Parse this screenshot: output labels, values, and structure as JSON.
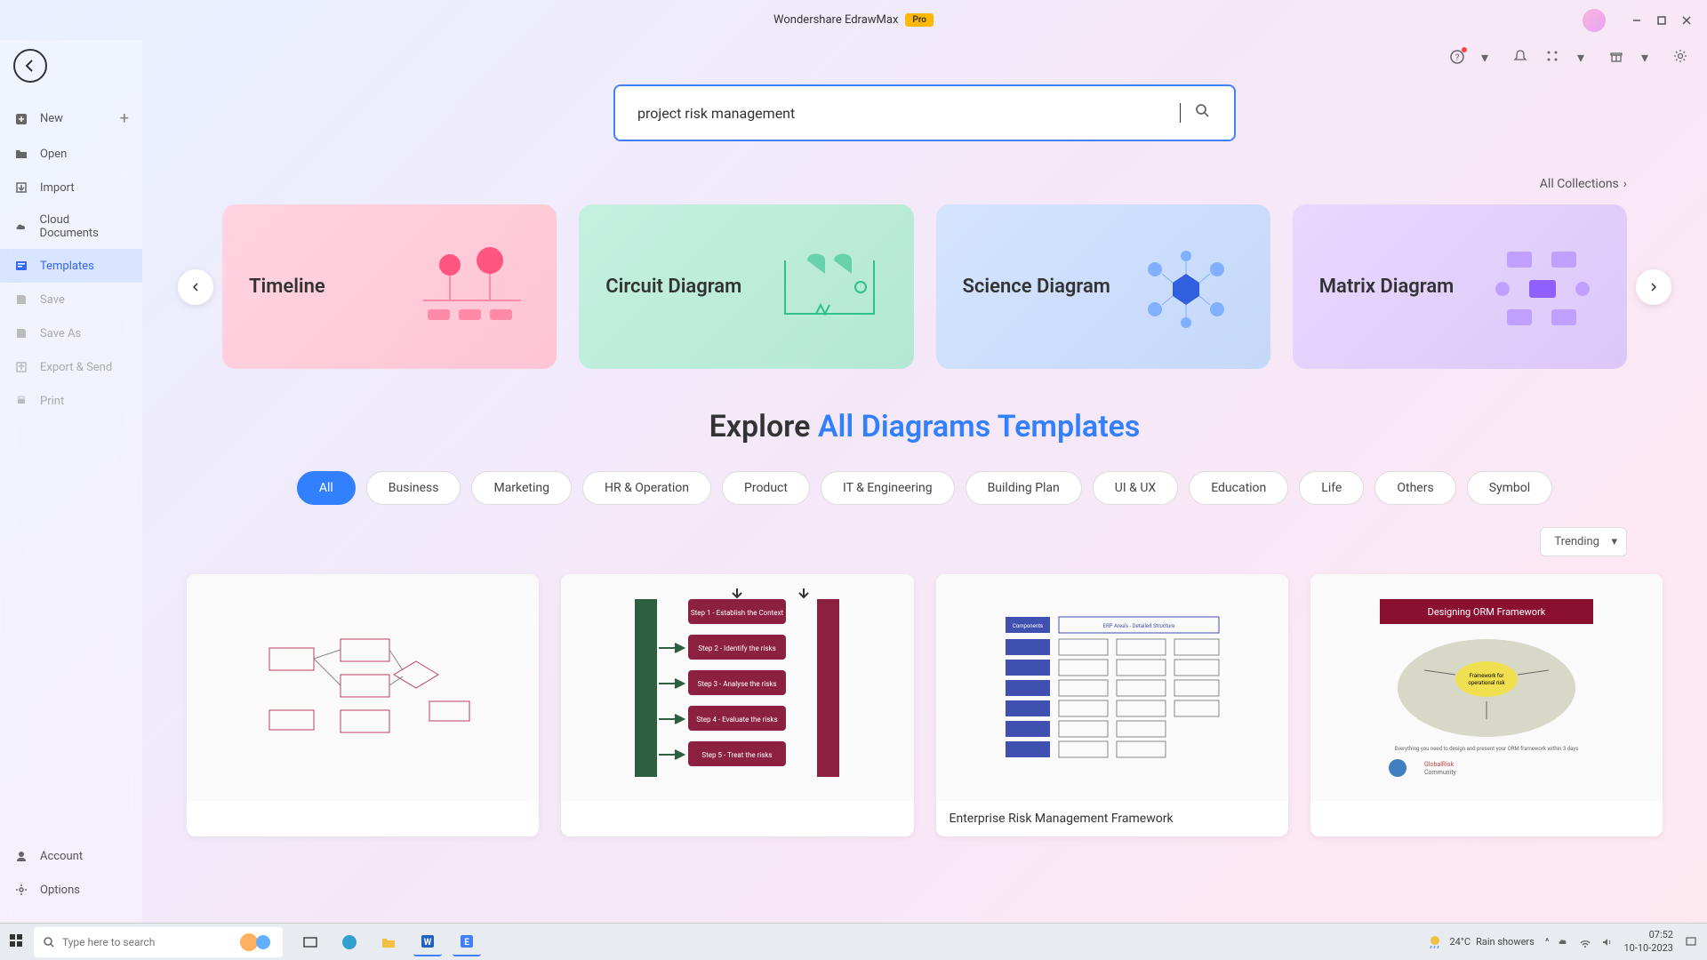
{
  "app": {
    "title": "Wondershare EdrawMax",
    "badge": "Pro"
  },
  "sidebar": {
    "items": [
      {
        "label": "New",
        "icon": "plus-square"
      },
      {
        "label": "Open",
        "icon": "folder"
      },
      {
        "label": "Import",
        "icon": "import"
      },
      {
        "label": "Cloud Documents",
        "icon": "cloud"
      },
      {
        "label": "Templates",
        "icon": "template"
      },
      {
        "label": "Save",
        "icon": "save"
      },
      {
        "label": "Save As",
        "icon": "save-as"
      },
      {
        "label": "Export & Send",
        "icon": "export"
      },
      {
        "label": "Print",
        "icon": "print"
      }
    ],
    "bottom": [
      {
        "label": "Account",
        "icon": "user"
      },
      {
        "label": "Options",
        "icon": "gear"
      }
    ]
  },
  "search": {
    "value": "project risk management"
  },
  "collections_link": "All Collections",
  "categories": [
    {
      "title": "Timeline",
      "color": "pink"
    },
    {
      "title": "Circuit Diagram",
      "color": "green"
    },
    {
      "title": "Science Diagram",
      "color": "blue"
    },
    {
      "title": "Matrix Diagram",
      "color": "purple"
    }
  ],
  "explore": {
    "prefix": "Explore ",
    "highlight": "All Diagrams Templates"
  },
  "filters": [
    "All",
    "Business",
    "Marketing",
    "HR & Operation",
    "Product",
    "IT & Engineering",
    "Building Plan",
    "UI & UX",
    "Education",
    "Life",
    "Others",
    "Symbol"
  ],
  "active_filter": "All",
  "sort": {
    "value": "Trending"
  },
  "templates": [
    {
      "title": ""
    },
    {
      "title": ""
    },
    {
      "title": "Enterprise Risk Management Framework"
    },
    {
      "title": ""
    }
  ],
  "taskbar": {
    "search_placeholder": "Type here to search",
    "weather": {
      "temp": "24°C",
      "desc": "Rain showers"
    },
    "time": "07:52",
    "date": "10-10-2023"
  }
}
